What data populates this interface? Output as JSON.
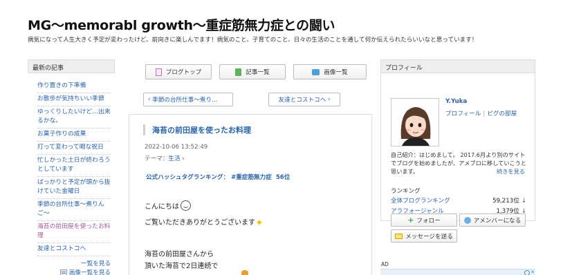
{
  "blog": {
    "title": "MG〜memorabl growth〜重症筋無力症との闘い",
    "description": "病気になって人生大きく予定が変わったけど、前向きに楽しんでます！病気のこと、子育てのこと、日々の生活のことを通して何か伝えられたらいいなと思っています！"
  },
  "left_sidebar": {
    "heading": "最新の記事",
    "items": [
      {
        "label": "作り置きの下準備"
      },
      {
        "label": "お散歩が気持ちいい季節"
      },
      {
        "label": "ゆっくりしたいけど…出来るかな。"
      },
      {
        "label": "お菓子作りの成果"
      },
      {
        "label": "打って変わって暇な祝日"
      },
      {
        "label": "忙しかった土日が終わろうとしています"
      },
      {
        "label": "ばっかりと予定が頭から抜けていた金曜日"
      },
      {
        "label": "季節の台所仕事〜煮りんご〜"
      },
      {
        "label": "海苔の前田屋を使ったお料理"
      },
      {
        "label": "友達とコストコへ"
      }
    ],
    "more_link": "一覧を見る",
    "image_list_link": "画像一覧を見る"
  },
  "tabs": {
    "blog_top": "ブログトップ",
    "article_list": "記事一覧",
    "image_list": "画像一覧"
  },
  "nav": {
    "prev": "季節の台所仕事〜煮り…",
    "next": "友達とコストコへ"
  },
  "article": {
    "title": "海苔の前田屋を使ったお料理",
    "date": "2022-10-06 13:52:49",
    "theme_label": "テーマ：",
    "theme_value": "生活",
    "hashtag_label": "公式ハッシュタグランキング：",
    "hashtag_tag": "#重症筋無力症",
    "hashtag_rank": "56位",
    "lines": [
      "こんにちは",
      "ご覧いただきありがとうございます",
      "海苔の前田屋さんから",
      "頂いた海苔で2日連続で"
    ]
  },
  "profile": {
    "heading": "プロフィール",
    "username": "Y.Yuka",
    "profile_link": "プロフィール",
    "pigg_link": "ピグの部屋",
    "intro": "自己紹介：はじめまして。 2017.6月より別のサイトでブログを始めましたが、アメブロに移していこうと思います。",
    "more": "続きを見る",
    "ranking_heading": "ランキング",
    "rankings": [
      {
        "label": "全体ブログランキング",
        "value": "59,213位"
      },
      {
        "label": "アラフォージャンル",
        "value": "1,379位"
      }
    ],
    "follow_button": "フォロー",
    "ameba_button": "アメンバーになる",
    "message_button": "メッセージを送る"
  },
  "ad": {
    "label": "AD"
  },
  "colors": {
    "link": "#2a63a8",
    "current_item": "#a05a9a"
  }
}
